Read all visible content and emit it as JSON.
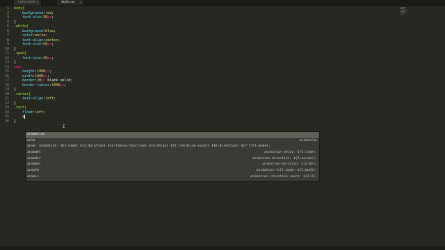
{
  "tabs": [
    {
      "label": "index.html",
      "active": false
    },
    {
      "label": "style.css",
      "active": true
    }
  ],
  "line_numbers": [
    "1",
    "2",
    "3",
    "4",
    "5",
    "6",
    "7",
    "8",
    "9",
    "10",
    "11",
    "12",
    "13",
    "14",
    "15",
    "16",
    "17",
    "18",
    "19",
    "20",
    "21",
    "22",
    "23",
    "24",
    "25",
    "26"
  ],
  "code": {
    "l1_sel": "body{",
    "l2_prop": "background",
    "l2_val": "red",
    "l3_prop": "font-size",
    "l3_num": "30",
    "l3_unit": "px",
    "l4": "}",
    "l5_sel": ".white{",
    "l6_prop": "background",
    "l6_val": "blue",
    "l7_prop": "color",
    "l7_val": "white",
    "l8_prop": "text-align",
    "l8_val": "center",
    "l9_prop": "font-size",
    "l9_num": "50",
    "l9_unit": "px",
    "l10": "}",
    "l11_sel": ".span{",
    "l12_prop": "font-size",
    "l12_num": "20",
    "l12_unit": "px",
    "l13": "}",
    "l14_sel": "img{",
    "l15_prop": "height",
    "l15_num": "1000",
    "l15_unit": "px",
    "l16_prop": "width",
    "l16_num": "1000",
    "l16_unit": "px",
    "l17_prop": "border",
    "l17_num": "20",
    "l17_unit": "px",
    "l17_rest": " black solid",
    "l18_prop": "border-radius",
    "l18_num": "1000",
    "l18_unit": "px",
    "l19": "}",
    "l20_sel": ".center{",
    "l21_prop": "text-align",
    "l21_val": "left",
    "l22": "}",
    "l23_sel": ".text{",
    "l24_prop": "float",
    "l24_val": "left",
    "l25_typed": "a",
    "l26": "}"
  },
  "autocomplete": {
    "items": [
      {
        "trigger": "animation",
        "hint": "",
        "selected": true
      },
      {
        "trigger": "anim",
        "hint": "animation",
        "selected": false
      },
      {
        "trigger": "anim- animation: ${1:name} ${2:duration} ${3:timing-function} ${4:delay} ${5:iteration-count} ${6:direction} ${7:fill-mode};",
        "hint": "",
        "selected": false
      },
      {
        "trigger": "animdel",
        "hint": "animation-delay: ${1:time};",
        "selected": false
      },
      {
        "trigger": "animdir",
        "hint": "animation-direction: ${1:normal};",
        "selected": false
      },
      {
        "trigger": "animdur",
        "hint": "animation-duration: ${1:0}s;",
        "selected": false
      },
      {
        "trigger": "animfm",
        "hint": "animation-fill-mode: ${1:both};",
        "selected": false
      },
      {
        "trigger": "animic",
        "hint": "animation-iteration-count: ${1:1};",
        "selected": false
      }
    ]
  },
  "colors": {
    "background": "#272822",
    "selector": "#a6e22e",
    "property": "#66d9ef",
    "value": "#e6db74",
    "unit": "#f92672"
  }
}
